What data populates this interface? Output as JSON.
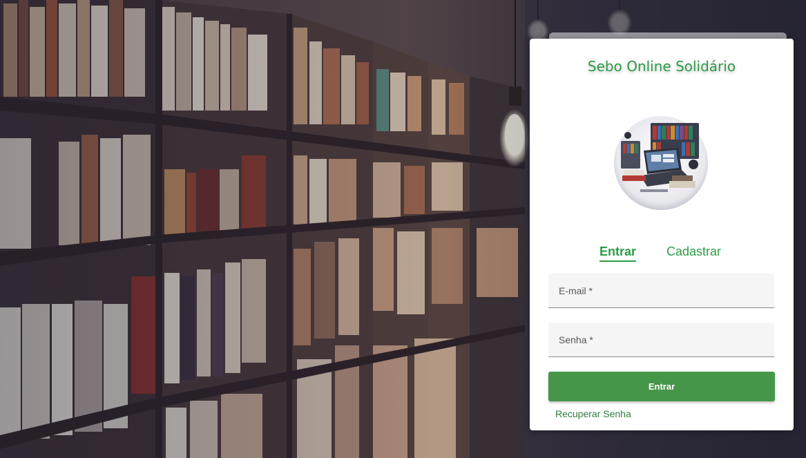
{
  "app": {
    "title": "Sebo Online Solidário"
  },
  "logo": {
    "icon": "bookstore-laptop-illustration"
  },
  "tabs": [
    {
      "label": "Entrar",
      "active": true
    },
    {
      "label": "Cadastrar",
      "active": false
    }
  ],
  "form": {
    "email_label": "E-mail *",
    "password_label": "Senha *",
    "submit_label": "Entrar",
    "recover_label": "Recuperar Senha"
  },
  "colors": {
    "brand_green": "#2e9b46",
    "button_green": "#46964a",
    "field_bg": "#f5f5f5"
  }
}
